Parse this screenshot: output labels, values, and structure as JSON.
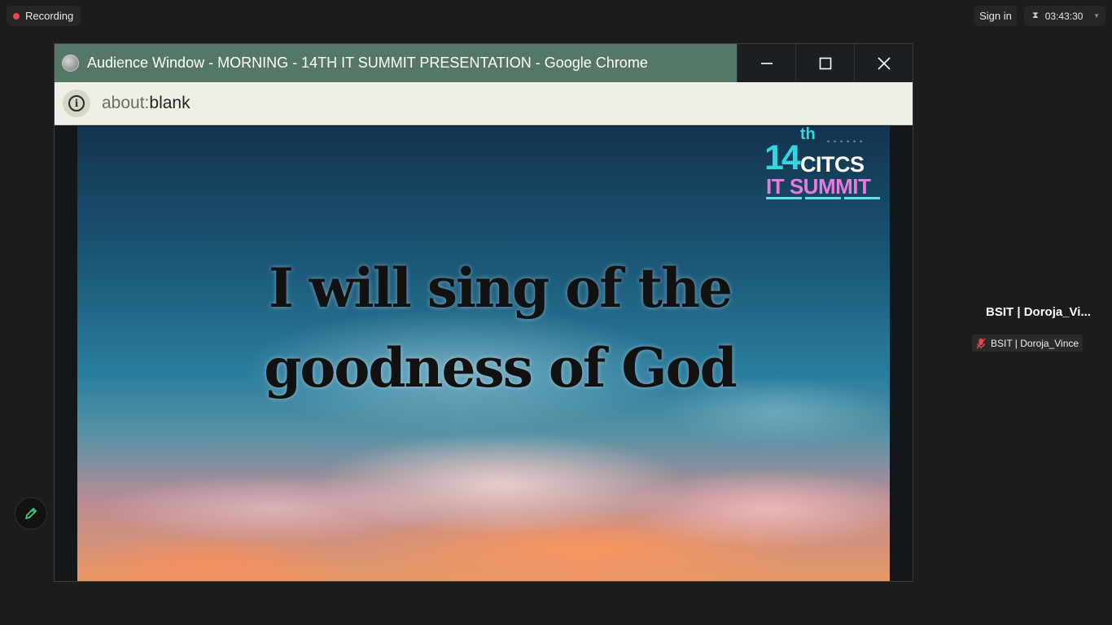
{
  "topbar": {
    "recording_label": "Recording",
    "signin_label": "Sign in",
    "timer": "03:43:30"
  },
  "shared_window": {
    "title": "Audience Window - MORNING - 14TH IT SUMMIT PRESENTATION - Google Chrome",
    "address_scheme": "about:",
    "address_path": "blank",
    "slide": {
      "logo": {
        "number": "14",
        "suffix": "th",
        "org": "CITCS",
        "event": "IT SUMMIT"
      },
      "lyric_line1": "I will sing of the",
      "lyric_line2": "goodness of God"
    }
  },
  "participant": {
    "display_name": "BSIT | Doroja_Vi...",
    "tag_name": "BSIT | Doroja_Vince"
  },
  "colors": {
    "titlebar": "#557766",
    "recording_dot": "#e5484d",
    "logo_cyan": "#36d3e0",
    "logo_pink": "#e67adf",
    "annotate_green": "#3ddc84"
  }
}
